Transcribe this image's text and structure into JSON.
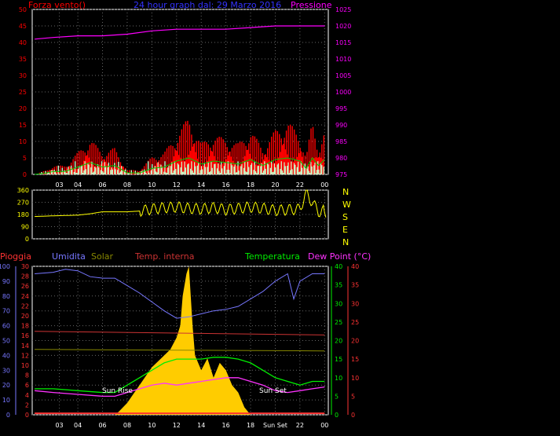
{
  "header": {
    "left_label": "Forza vento()",
    "title": "24 hour graph dal: 29 Marzo 2016",
    "right_label": "Pressione"
  },
  "direction_labels": [
    "N",
    "W",
    "S",
    "E",
    "N"
  ],
  "bottom_header": {
    "pioggia": "Pioggia",
    "umidita": "Umidita",
    "solar": "Solar",
    "temp_interna": "Temp. interna",
    "temperatura": "Temperatura",
    "dew_point": "Dew Point (°C)"
  },
  "annotations": {
    "sun_rise": "Sun Rise",
    "sun_set": "Sun Set",
    "sun_set_axis": "Sun Set"
  },
  "colors": {
    "wind_avg": "#ff0000",
    "wind_gust_band": "#00cc00",
    "wind_light": "#ccffcc",
    "pressure": "#ff00ff",
    "direction": "#ffff00",
    "humidity": "#7777ff",
    "solar_line": "#888800",
    "solar_fill": "#ffcc00",
    "temp_interna": "#cc3333",
    "temperatura": "#00ee00",
    "dew_point": "#ff33ff",
    "rain": "#ff3333"
  },
  "chart_data": [
    {
      "id": "wind-pressure",
      "type": "line",
      "x_ticks": [
        "03",
        "04",
        "06",
        "08",
        "10",
        "12",
        "14",
        "16",
        "18",
        "20",
        "22",
        "00"
      ],
      "x_hours": [
        2.5,
        4,
        6,
        8,
        10,
        12,
        14,
        16,
        18,
        20,
        22,
        24
      ],
      "left_axis": {
        "label": "Forza vento()",
        "ticks": [
          0,
          5,
          10,
          15,
          20,
          25,
          30,
          35,
          40,
          45,
          50
        ],
        "range": [
          0,
          50
        ]
      },
      "right_axis": {
        "label": "Pressione",
        "ticks": [
          975,
          980,
          985,
          990,
          995,
          1000,
          1005,
          1010,
          1015,
          1020,
          1025
        ],
        "range": [
          975,
          1025
        ]
      },
      "series": [
        {
          "name": "Pressione",
          "axis": "right",
          "x": [
            0.5,
            2,
            4,
            6,
            8,
            10,
            12,
            14,
            16,
            18,
            20,
            22,
            24
          ],
          "y": [
            1016,
            1016.5,
            1017,
            1017,
            1017.5,
            1018.5,
            1019,
            1019,
            1019,
            1019.5,
            1020,
            1020,
            1020
          ]
        },
        {
          "name": "Forza vento()",
          "axis": "left",
          "x": [
            0.5,
            1.5,
            2,
            3,
            4,
            5,
            6,
            7,
            8,
            9,
            10,
            11,
            12,
            13,
            14,
            15,
            16,
            17,
            18,
            19,
            20,
            21,
            22,
            22.5,
            23,
            23.5,
            24
          ],
          "y": [
            0,
            1,
            2,
            2,
            5,
            8,
            5,
            6,
            1,
            1,
            4,
            5,
            9,
            13,
            7,
            9,
            8,
            7,
            10,
            6,
            10,
            12,
            9,
            4,
            12,
            6,
            10
          ]
        }
      ]
    },
    {
      "id": "wind-direction",
      "type": "line",
      "left_axis": {
        "ticks": [
          0,
          90,
          180,
          270,
          360
        ],
        "range": [
          0,
          360
        ]
      },
      "series": [
        {
          "name": "",
          "x": [
            0.5,
            2,
            4,
            5,
            6,
            8,
            9,
            10,
            11,
            12,
            13,
            14,
            15,
            16,
            17,
            18,
            19,
            20,
            21,
            22,
            22.5,
            23.5,
            24
          ],
          "y": [
            165,
            170,
            175,
            185,
            200,
            200,
            205,
            220,
            230,
            235,
            225,
            220,
            230,
            215,
            225,
            235,
            225,
            210,
            215,
            220,
            340,
            200,
            210
          ]
        }
      ]
    },
    {
      "id": "temp-hum-solar",
      "type": "line",
      "x_ticks": [
        "03",
        "04",
        "06",
        "08",
        "10",
        "12",
        "14",
        "16",
        "18",
        "Sun Set",
        "22",
        "00"
      ],
      "axes": {
        "pioggia": {
          "ticks": [
            0,
            10,
            20,
            30,
            40,
            50,
            60,
            70,
            80,
            90,
            100
          ],
          "range": [
            0,
            100
          ]
        },
        "second": {
          "ticks": [
            0,
            2,
            4,
            6,
            8,
            10,
            12,
            14,
            16,
            18,
            20,
            22,
            24,
            26,
            28,
            30
          ],
          "range": [
            0,
            30
          ]
        },
        "temperatura": {
          "ticks": [
            0,
            5,
            10,
            15,
            20,
            25,
            30,
            35,
            40
          ],
          "range": [
            0,
            40
          ]
        },
        "dew_point": {
          "ticks": [
            0,
            5,
            10,
            15,
            20,
            25,
            30,
            35,
            40
          ],
          "range": [
            0,
            40
          ]
        }
      },
      "series": [
        {
          "name": "Umidita",
          "axis": "pioggia",
          "x": [
            0.5,
            2,
            3,
            4,
            5,
            6,
            7,
            8,
            9,
            10,
            11,
            12,
            13,
            14,
            15,
            16,
            17,
            18,
            19,
            20,
            21,
            21.5,
            22,
            23,
            24
          ],
          "y": [
            95,
            96,
            98,
            97,
            93,
            92,
            92,
            87,
            82,
            76,
            70,
            65,
            66,
            68,
            70,
            71,
            73,
            78,
            83,
            90,
            95,
            78,
            90,
            95,
            95
          ]
        },
        {
          "name": "Solar",
          "axis": "pioggia",
          "x": [
            0.5,
            24
          ],
          "y": [
            44,
            43
          ]
        },
        {
          "name": "Temp. interna",
          "axis": "temperatura",
          "x": [
            0.5,
            24
          ],
          "y": [
            22.5,
            21.5
          ]
        },
        {
          "name": "Temperatura",
          "axis": "temperatura",
          "x": [
            0.5,
            2,
            4,
            6,
            7,
            8,
            9,
            10,
            11,
            12,
            13,
            14,
            15,
            16,
            17,
            18,
            19,
            20,
            21,
            22,
            23,
            24
          ],
          "y": [
            7,
            7,
            6.5,
            6,
            6,
            8,
            10,
            12,
            14,
            15,
            15,
            15,
            15.5,
            15.5,
            15,
            14,
            12,
            10,
            9,
            8,
            9,
            9
          ]
        },
        {
          "name": "Dew Point (°C)",
          "axis": "dew_point",
          "x": [
            0.5,
            2,
            4,
            6,
            7,
            8,
            9,
            10,
            11,
            12,
            13,
            14,
            15,
            16,
            17,
            18,
            19,
            20,
            21,
            22,
            23,
            24
          ],
          "y": [
            6.5,
            6,
            5.5,
            5,
            5,
            6,
            7,
            8,
            8.5,
            8,
            8.5,
            9,
            9.5,
            10,
            10,
            9,
            8,
            6.5,
            6,
            6.5,
            7,
            7.5
          ]
        },
        {
          "name": "solar-fill",
          "axis": "pioggia",
          "x": [
            7,
            7.3,
            8,
            8.5,
            9,
            9.5,
            10,
            10.5,
            11,
            11.5,
            12,
            12.3,
            12.5,
            12.8,
            13,
            13.3,
            13.5,
            14,
            14.5,
            15,
            15.5,
            16,
            16.5,
            17,
            17.5,
            18
          ],
          "y": [
            0,
            2,
            8,
            14,
            20,
            26,
            32,
            36,
            40,
            44,
            52,
            60,
            80,
            95,
            100,
            60,
            40,
            30,
            38,
            25,
            35,
            30,
            20,
            15,
            5,
            0
          ]
        },
        {
          "name": "Pioggia",
          "axis": "pioggia",
          "x": [
            0.5,
            24
          ],
          "y": [
            1,
            1
          ]
        }
      ]
    }
  ]
}
